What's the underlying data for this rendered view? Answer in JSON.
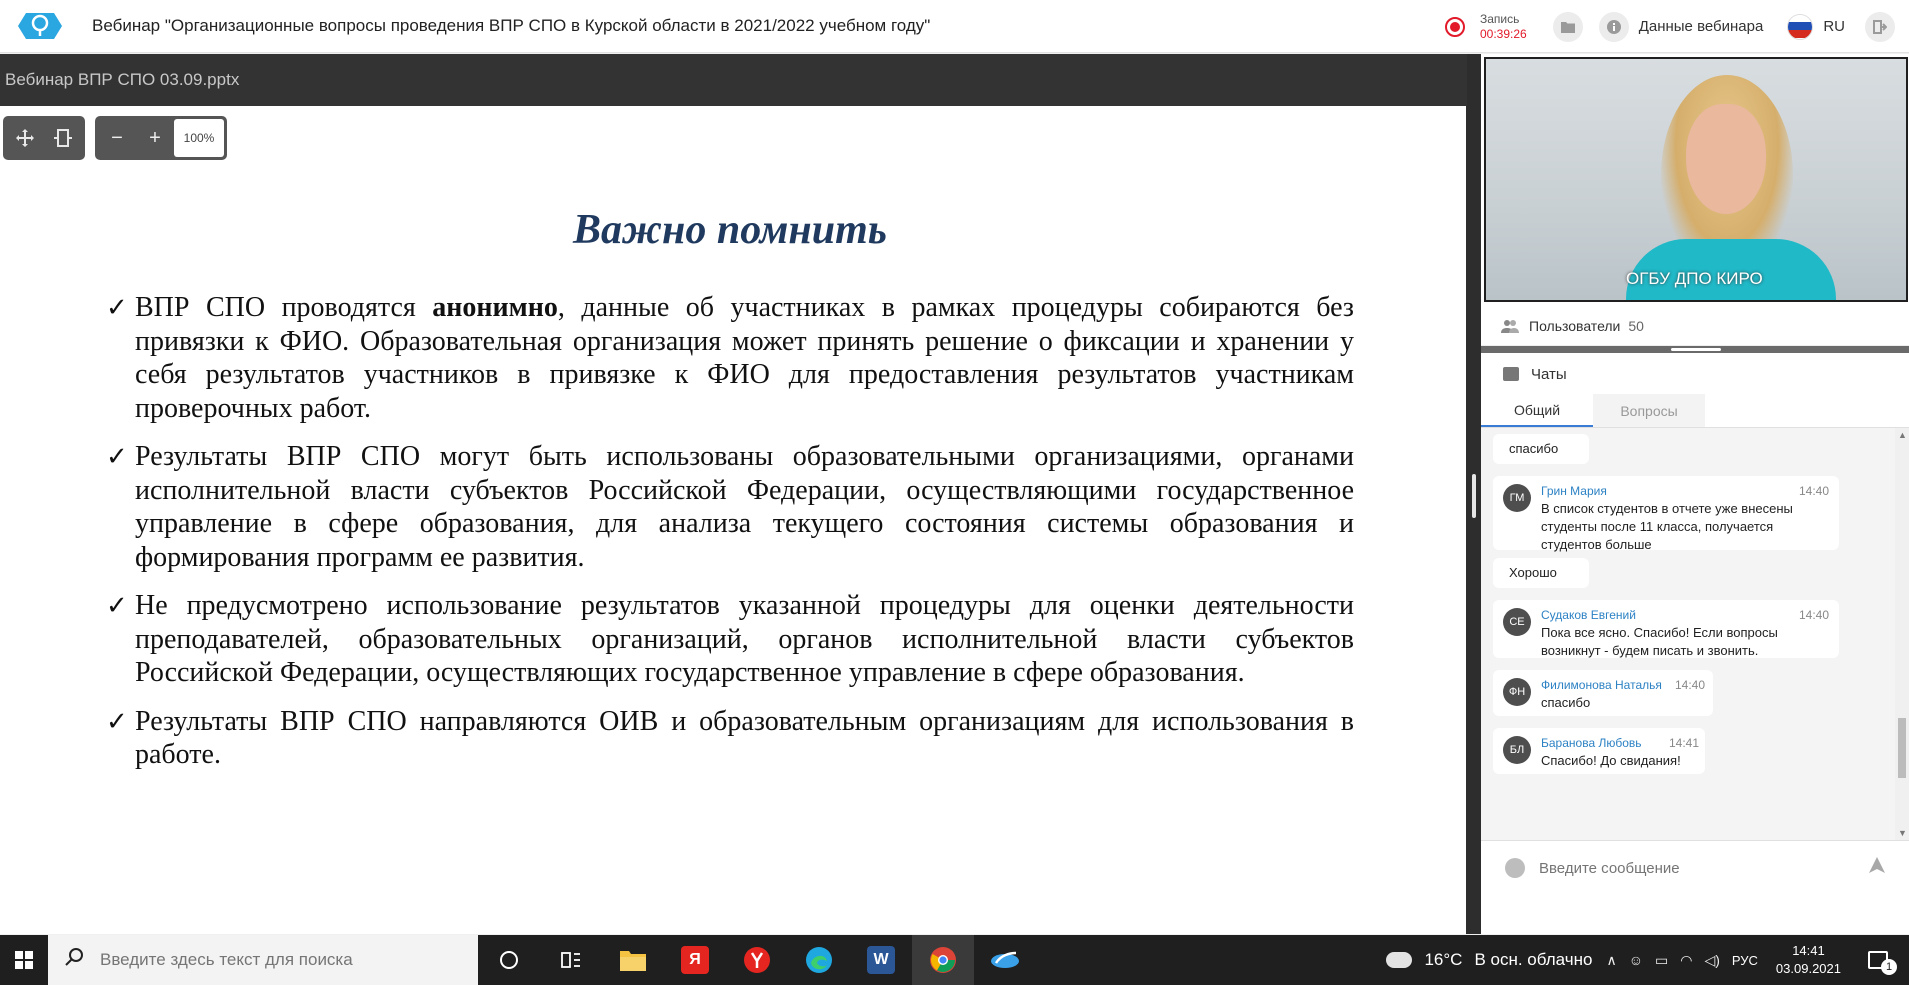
{
  "header": {
    "title": "Вебинар \"Организационные вопросы проведения ВПР СПО в Курской области в 2021/2022 учебном году\"",
    "record_label": "Запись",
    "record_time": "00:39:26",
    "webinar_data_label": "Данные вебинара",
    "language": "RU"
  },
  "presentation": {
    "file_name": "Вебинар ВПР СПО 03.09.pptx",
    "zoom": "100%",
    "zoom_out_symbol": "−",
    "zoom_in_symbol": "+",
    "slide": {
      "heading": "Важно помнить",
      "bullets": [
        {
          "before": "ВПР СПО проводятся ",
          "bold": "анонимно",
          "after": ", данные об участниках в рамках процедуры собираются без привязки к ФИО. Образовательная организация может принять решение о фиксации и хранении у себя результатов участников в привязке к ФИО для предоставления результатов участникам проверочных работ."
        },
        {
          "before": "Результаты ВПР СПО могут быть использованы образовательными организациями, органами исполнительной власти субъектов Российской Федерации, осуществляющими государственное управление в сфере образования, для анализа текущего состояния системы образования и формирования программ ее развития.",
          "bold": "",
          "after": ""
        },
        {
          "before": "Не предусмотрено использование результатов указанной процедуры для оценки деятельности преподавателей, образовательных организаций, органов исполнительной власти субъектов Российской Федерации, осуществляющих государственное управление в сфере образования.",
          "bold": "",
          "after": ""
        },
        {
          "before": "Результаты ВПР СПО направляются ОИВ и образовательным организациям для использования в работе.",
          "bold": "",
          "after": ""
        }
      ]
    }
  },
  "video": {
    "label": "ОГБУ ДПО КИРО"
  },
  "users": {
    "label": "Пользователи",
    "count": "50"
  },
  "chat": {
    "title": "Чаты",
    "tabs": [
      "Общий",
      "Вопросы"
    ],
    "input_placeholder": "Введите сообщение",
    "messages": [
      {
        "initials": "",
        "author": "",
        "time": "",
        "text": "спасибо"
      },
      {
        "initials": "ГМ",
        "author": "Грин Мария",
        "time": "14:40",
        "text": "В список студентов в отчете уже внесены студенты после 11 класса, получается студентов больше"
      },
      {
        "initials": "",
        "author": "",
        "time": "",
        "text": "Хорошо"
      },
      {
        "initials": "СЕ",
        "author": "Судаков Евгений",
        "time": "14:40",
        "text": "Пока все ясно. Спасибо! Если вопросы возникнут - будем писать и звонить."
      },
      {
        "initials": "ФН",
        "author": "Филимонова Наталья",
        "time": "14:40",
        "text": "спасибо"
      },
      {
        "initials": "БЛ",
        "author": "Баранова Любовь",
        "time": "14:41",
        "text": "Спасибо! До свидания!"
      }
    ]
  },
  "taskbar": {
    "search_placeholder": "Введите здесь текст для поиска",
    "yandex_letter": "Я",
    "word_letter": "W",
    "weather_temp": "16°C",
    "weather_text": "В осн. облачно",
    "input_language": "РУС",
    "time": "14:41",
    "date": "03.09.2021",
    "notification_count": "1"
  },
  "colors": {
    "accent_blue": "#2d82c4",
    "record_red": "#e21a2a",
    "slide_heading": "#1f3a5e"
  }
}
